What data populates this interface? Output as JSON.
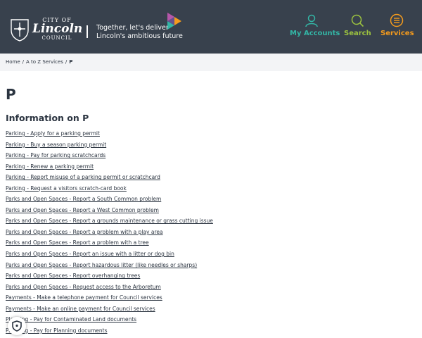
{
  "header": {
    "logo": {
      "line1": "CITY OF",
      "line2": "Lincoln",
      "line3": "COUNCIL"
    },
    "tagline_line1": "Together, let's deliver",
    "tagline_line2": "Lincoln's ambitious future",
    "nav": {
      "account_label": "My Accounts",
      "search_label": "Search",
      "services_label": "Services"
    },
    "colors": {
      "background": "#38414d",
      "account": "#33b6a6",
      "search": "#9cc23f",
      "services": "#f59b1c"
    }
  },
  "breadcrumb": {
    "items": [
      "Home",
      "A to Z Services",
      "P"
    ],
    "separator": "/"
  },
  "page_title": "P",
  "section_title": "Information on P",
  "links": [
    "Parking - Apply for a parking permit",
    "Parking - Buy a season parking permit",
    "Parking - Pay for parking scratchcards",
    "Parking - Renew a parking permit",
    "Parking - Report misuse of a parking permit or scratchcard",
    "Parking - Request a visitors scratch-card book",
    "Parks and Open Spaces - Report a South Common problem",
    "Parks and Open Spaces - Report a West Common problem",
    "Parks and Open Spaces - Report a grounds maintenance or grass cutting issue",
    "Parks and Open Spaces - Report a problem with a play area",
    "Parks and Open Spaces - Report a problem with a tree",
    "Parks and Open Spaces - Report an issue with a litter or dog bin",
    "Parks and Open Spaces - Report hazardous litter (like needles or sharps)",
    "Parks and Open Spaces - Report overhanging trees",
    "Parks and Open Spaces - Request access to the Arboretum",
    "Payments - Make a telephone payment for Council services",
    "Payments - Make an online payment for Council services",
    "Planning - Pay for Contaminated Land documents",
    "Planning - Pay for Planning documents"
  ],
  "icons": {
    "account": "user-icon",
    "search": "search-icon",
    "services": "menu-icon",
    "cookie": "shield-icon"
  }
}
